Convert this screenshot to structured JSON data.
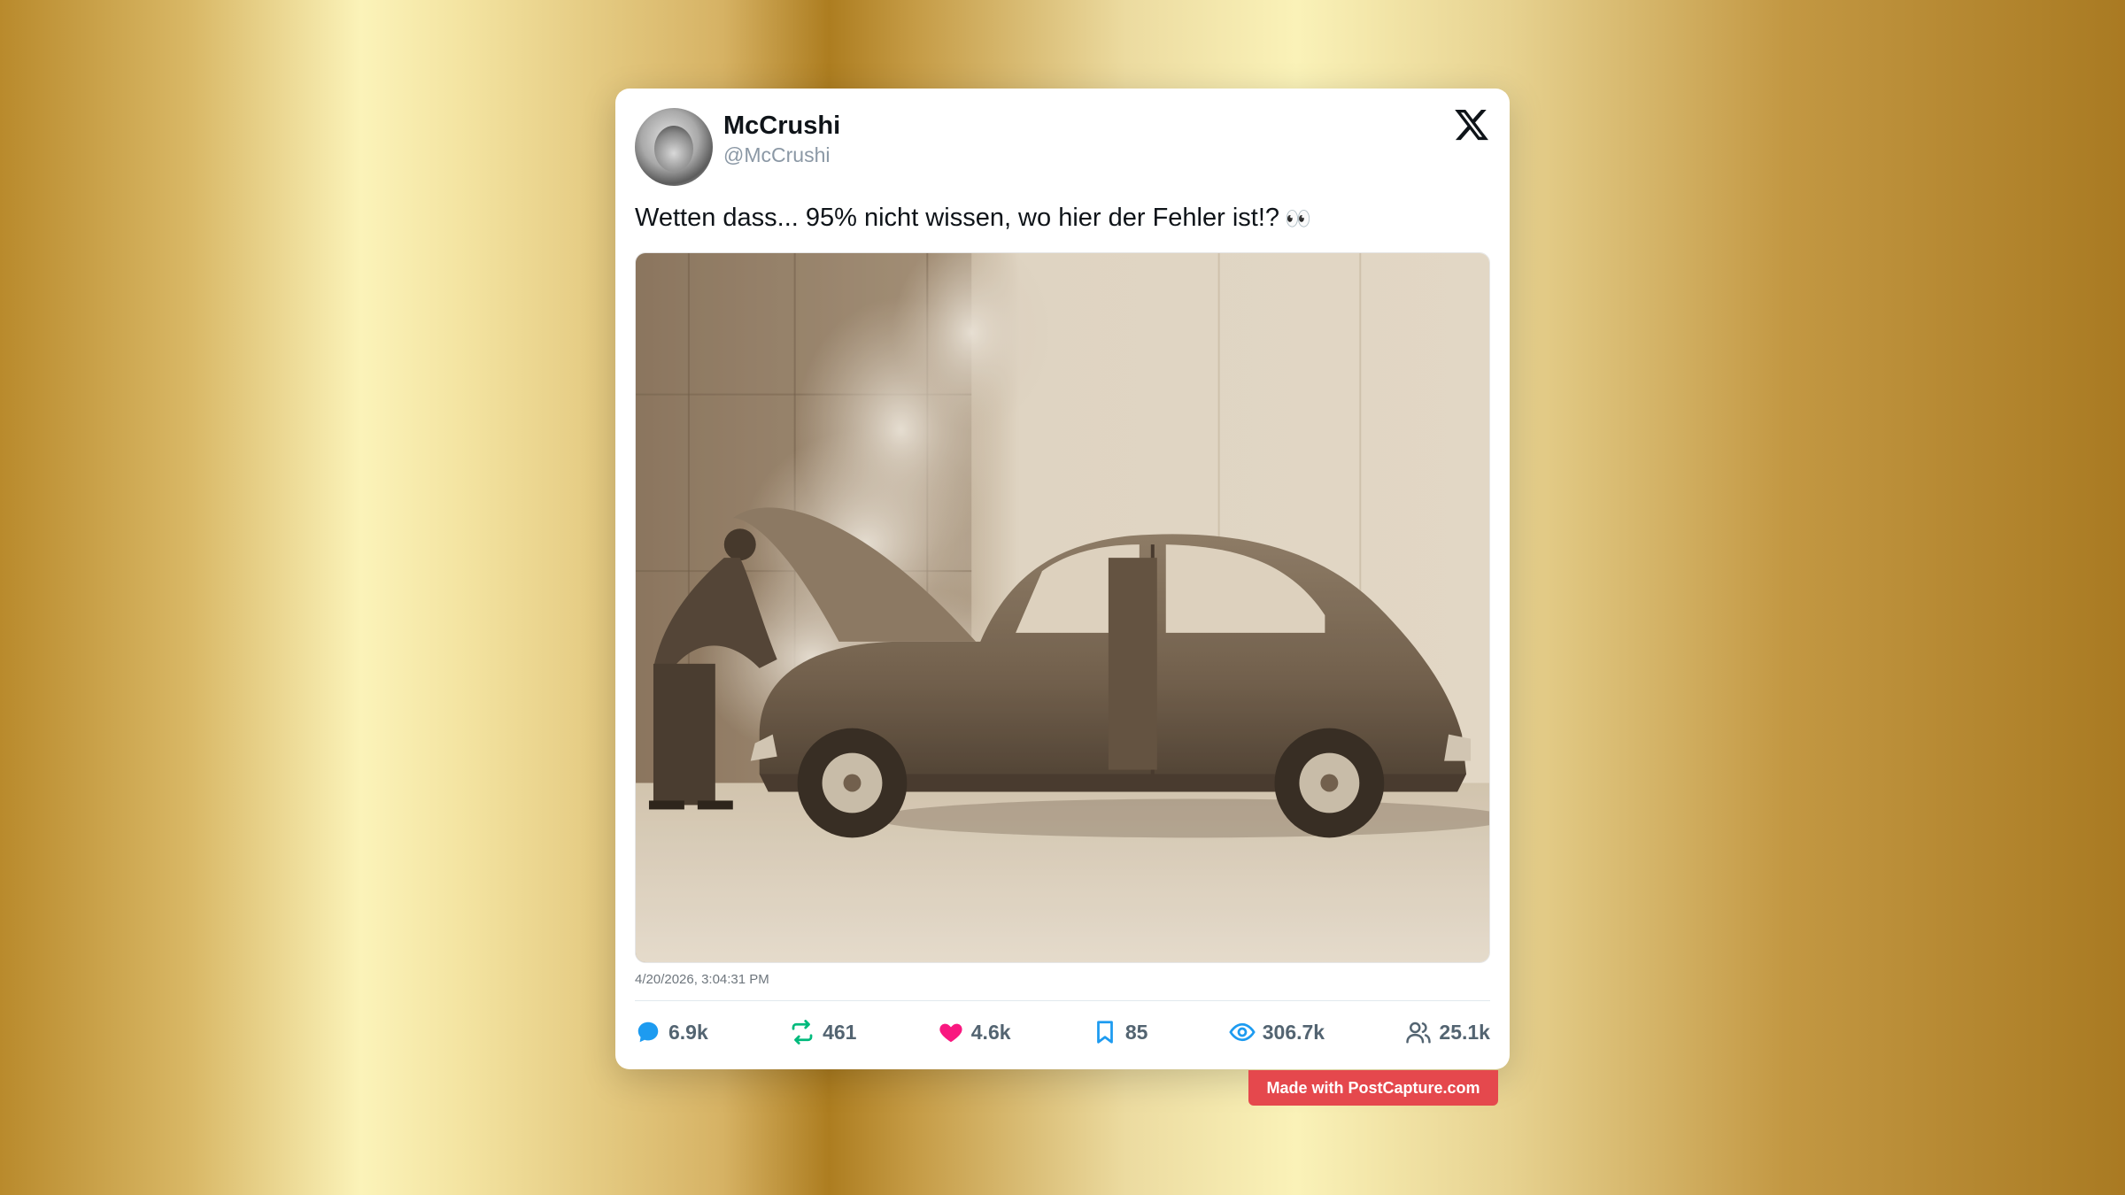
{
  "post": {
    "author": {
      "display_name": "McCrushi",
      "handle": "@McCrushi"
    },
    "text": "Wetten dass... 95% nicht wissen, wo hier der Fehler ist!?",
    "emoji": "👀",
    "timestamp": "4/20/2026, 3:04:31 PM",
    "stats": {
      "replies": "6.9k",
      "reposts": "461",
      "likes": "4.6k",
      "bookmarks": "85",
      "views": "306.7k",
      "followers": "25.1k"
    },
    "icons": [
      "x-logo-icon",
      "reply-icon",
      "repost-icon",
      "heart-icon",
      "bookmark-icon",
      "eye-icon",
      "people-icon"
    ]
  },
  "watermark": {
    "label": "Made with PostCapture.com"
  },
  "colors": {
    "reply": "#1d9bf0",
    "repost": "#00ba7c",
    "like": "#f91880",
    "bookmark": "#1d9bf0",
    "views": "#1d9bf0",
    "badge": "#e5484d"
  }
}
